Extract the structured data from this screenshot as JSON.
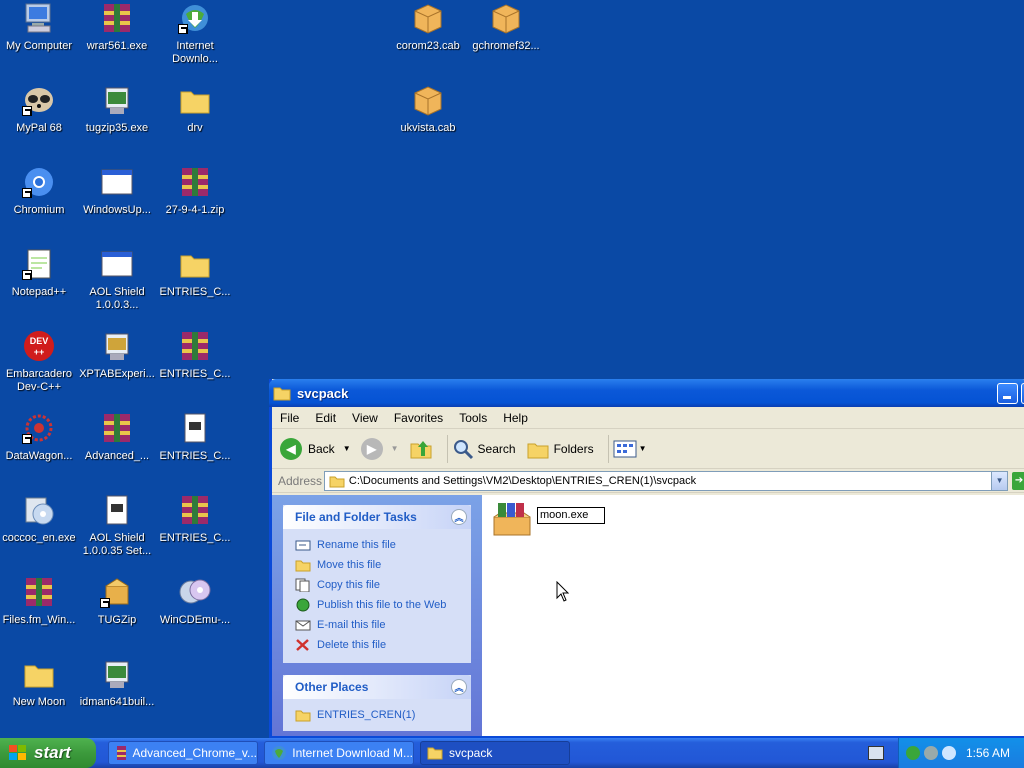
{
  "desktop": {
    "icons": [
      {
        "label": "My Computer",
        "icon": "my-computer-icon"
      },
      {
        "label": "wrar561.exe",
        "icon": "winrar-icon"
      },
      {
        "label": "Internet Downlo...",
        "icon": "internet-download-manager-icon"
      },
      {
        "label": "MyPal 68",
        "icon": "mypal-icon"
      },
      {
        "label": "tugzip35.exe",
        "icon": "installer-icon"
      },
      {
        "label": "drv",
        "icon": "folder-icon"
      },
      {
        "label": "Chromium",
        "icon": "chromium-icon"
      },
      {
        "label": "WindowsUp...",
        "icon": "window-app-icon"
      },
      {
        "label": "27-9-4-1.zip",
        "icon": "winrar-icon"
      },
      {
        "label": "Notepad++",
        "icon": "notepadpp-icon"
      },
      {
        "label": "AOL Shield 1.0.0.3...",
        "icon": "window-app-icon"
      },
      {
        "label": "ENTRIES_C...",
        "icon": "folder-icon"
      },
      {
        "label": "Embarcadero Dev-C++",
        "icon": "devcpp-icon"
      },
      {
        "label": "XPTABExperi...",
        "icon": "installer-icon"
      },
      {
        "label": "ENTRIES_C...",
        "icon": "winrar-icon"
      },
      {
        "label": "DataWagon...",
        "icon": "datawagon-icon"
      },
      {
        "label": "Advanced_...",
        "icon": "winrar-icon"
      },
      {
        "label": "ENTRIES_C...",
        "icon": "document-icon"
      },
      {
        "label": "coccoc_en.exe",
        "icon": "installer-cd-icon"
      },
      {
        "label": "AOL Shield 1.0.0.35 Set...",
        "icon": "document-icon"
      },
      {
        "label": "ENTRIES_C...",
        "icon": "winrar-icon"
      },
      {
        "label": "Files.fm_Win...",
        "icon": "winrar-icon"
      },
      {
        "label": "TUGZip",
        "icon": "tugzip-icon"
      },
      {
        "label": "WinCDEmu-...",
        "icon": "wincdemu-icon"
      },
      {
        "label": "New Moon",
        "icon": "folder-icon"
      },
      {
        "label": "idman641buil...",
        "icon": "installer-icon"
      },
      {
        "label": "corom23.cab",
        "icon": "cab-icon"
      },
      {
        "label": "gchromef32...",
        "icon": "cab-icon"
      },
      {
        "label": "ukvista.cab",
        "icon": "cab-icon"
      }
    ]
  },
  "window": {
    "title": "svcpack",
    "menu": [
      "File",
      "Edit",
      "View",
      "Favorites",
      "Tools",
      "Help"
    ],
    "toolbar": {
      "back": "Back",
      "search": "Search",
      "folders": "Folders"
    },
    "address_label": "Address",
    "address_value": "C:\\Documents and Settings\\VM2\\Desktop\\ENTRIES_CREN(1)\\svcpack",
    "file_tasks": {
      "title": "File and Folder Tasks",
      "items": [
        "Rename this file",
        "Move this file",
        "Copy this file",
        "Publish this file to the Web",
        "E-mail this file",
        "Delete this file"
      ]
    },
    "other_places": {
      "title": "Other Places",
      "items": [
        "ENTRIES_CREN(1)"
      ]
    },
    "file": {
      "rename_value": "moon.exe"
    }
  },
  "taskbar": {
    "start": "start",
    "tasks": [
      "Advanced_Chrome_v...",
      "Internet Download M...",
      "svcpack"
    ],
    "clock": "1:56 AM"
  }
}
